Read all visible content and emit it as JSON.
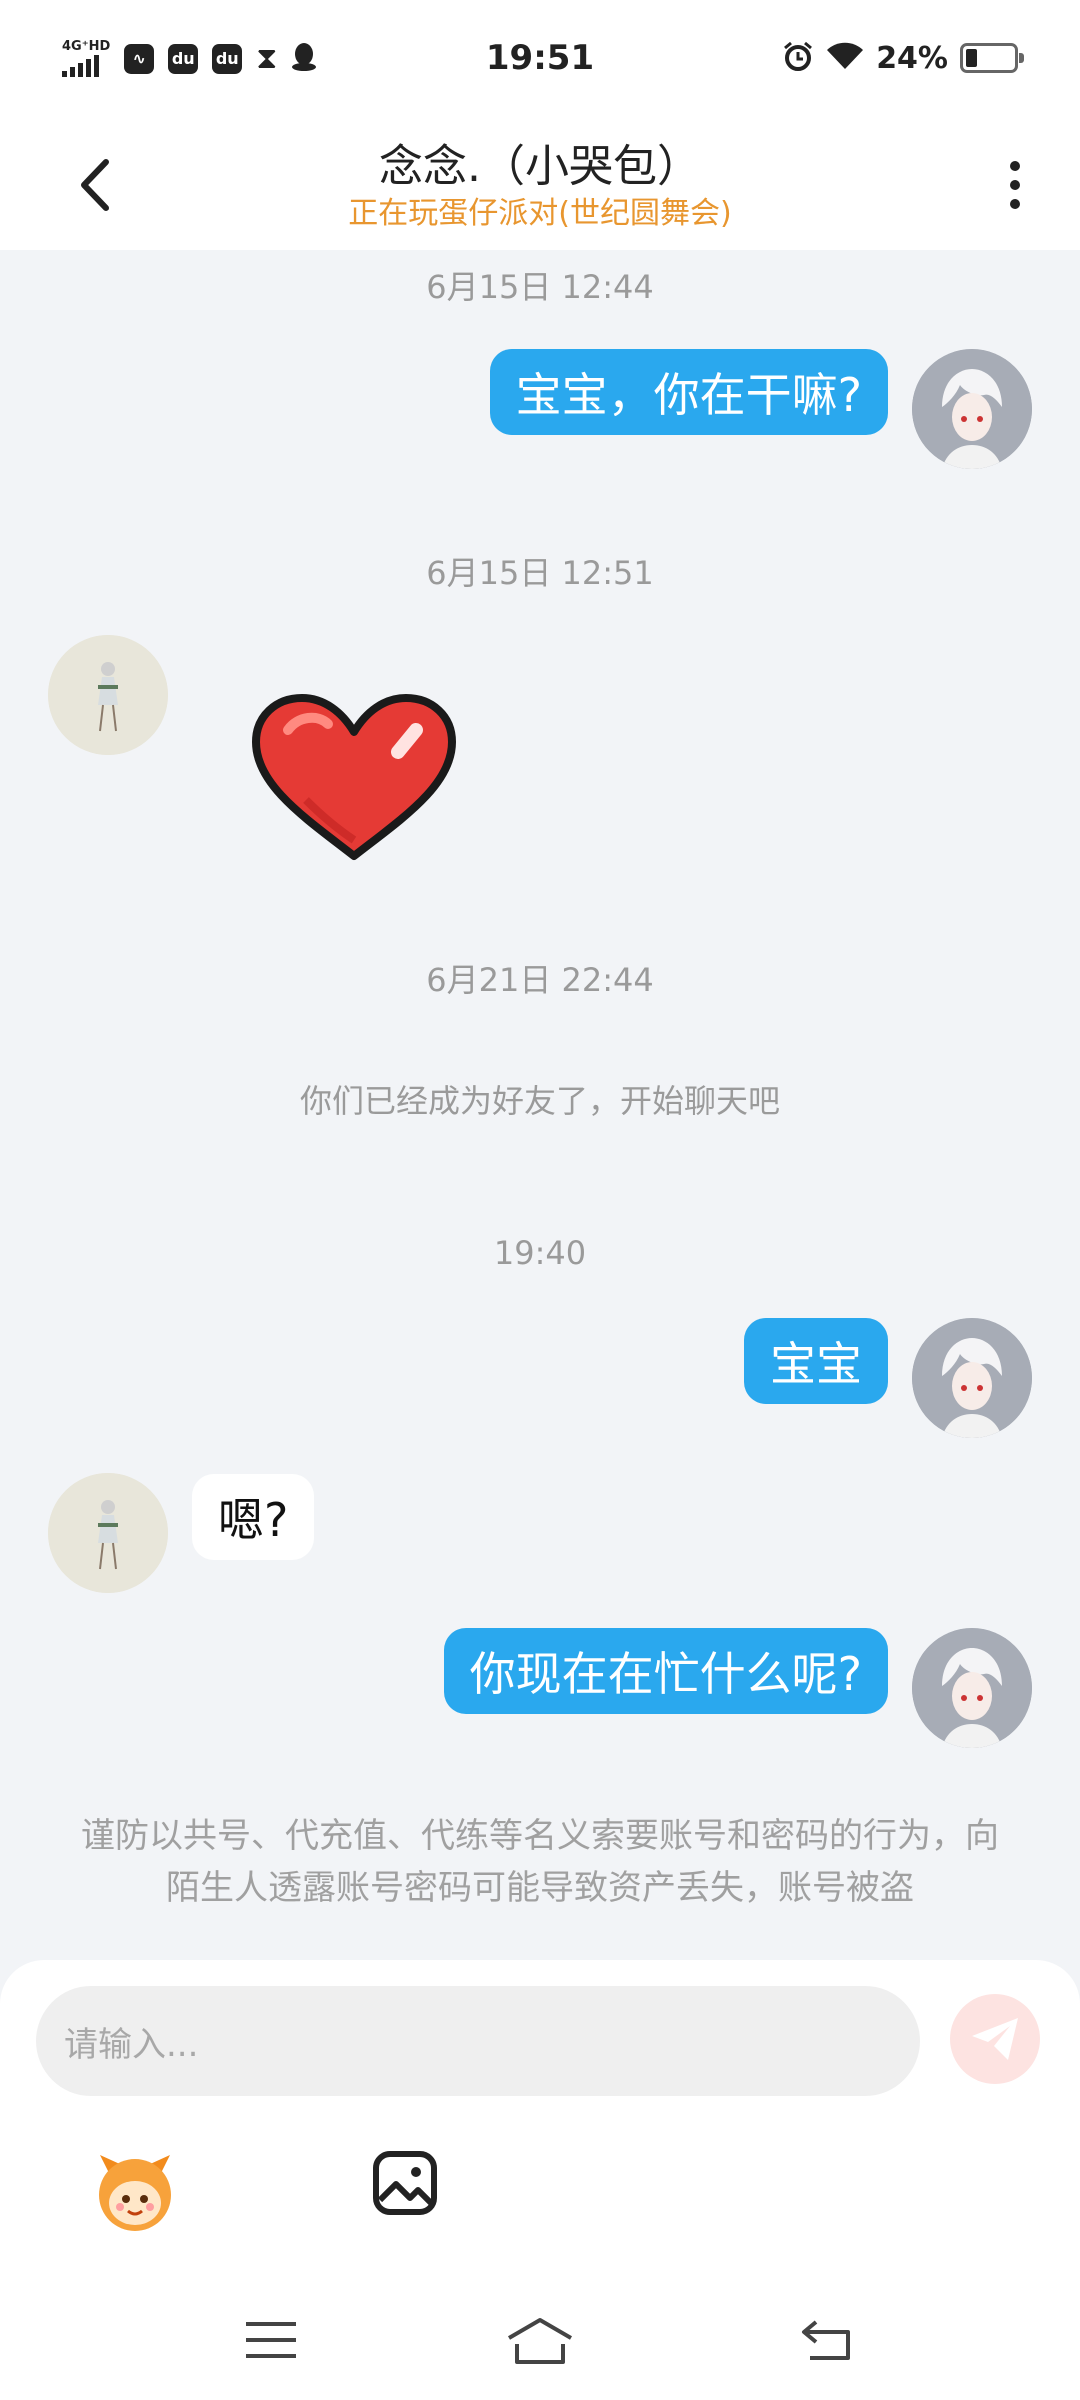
{
  "status_bar": {
    "network": "4G⁺HD",
    "time": "19:51",
    "battery": "24%",
    "left_icons": [
      "baidu-app-icon",
      "du-app-icon",
      "du-app-icon-2",
      "hourglass-icon",
      "qq-icon"
    ],
    "right_icons": [
      "alarm-icon",
      "wifi-icon",
      "battery-icon"
    ]
  },
  "header": {
    "title": "念念.（小哭包）",
    "subtitle": "正在玩蛋仔派对(世纪圆舞会)",
    "subtitle_color": "#e8962f"
  },
  "chat": {
    "messages": [
      {
        "type": "timestamp",
        "text": "6月15日 12:44"
      },
      {
        "type": "text",
        "from": "me",
        "text": "宝宝，你在干嘛?"
      },
      {
        "type": "timestamp",
        "text": "6月15日 12:51"
      },
      {
        "type": "sticker",
        "from": "them",
        "sticker": "red-heart-sticker"
      },
      {
        "type": "timestamp",
        "text": "6月21日 22:44"
      },
      {
        "type": "system",
        "text": "你们已经成为好友了，开始聊天吧"
      },
      {
        "type": "timestamp",
        "text": "19:40"
      },
      {
        "type": "text",
        "from": "me",
        "text": "宝宝"
      },
      {
        "type": "text",
        "from": "them",
        "text": "嗯?"
      },
      {
        "type": "text",
        "from": "me",
        "text": "你现在在忙什么呢?"
      }
    ],
    "warning": "谨防以共号、代充值、代练等名义索要账号和密码的行为，向陌生人透露账号密码可能导致资产丢失，账号被盗"
  },
  "input": {
    "placeholder": "请输入...",
    "send_icon": "paper-plane-icon"
  },
  "toolbar": {
    "items": [
      "mascot-emoji-icon",
      "image-picker-icon"
    ]
  },
  "nav": {
    "items": [
      "menu-icon",
      "home-icon",
      "back-icon"
    ]
  },
  "colors": {
    "accent_bubble": "#2aa8ee",
    "background": "#f2f4f7",
    "send_button_bg": "#fde3e1"
  }
}
